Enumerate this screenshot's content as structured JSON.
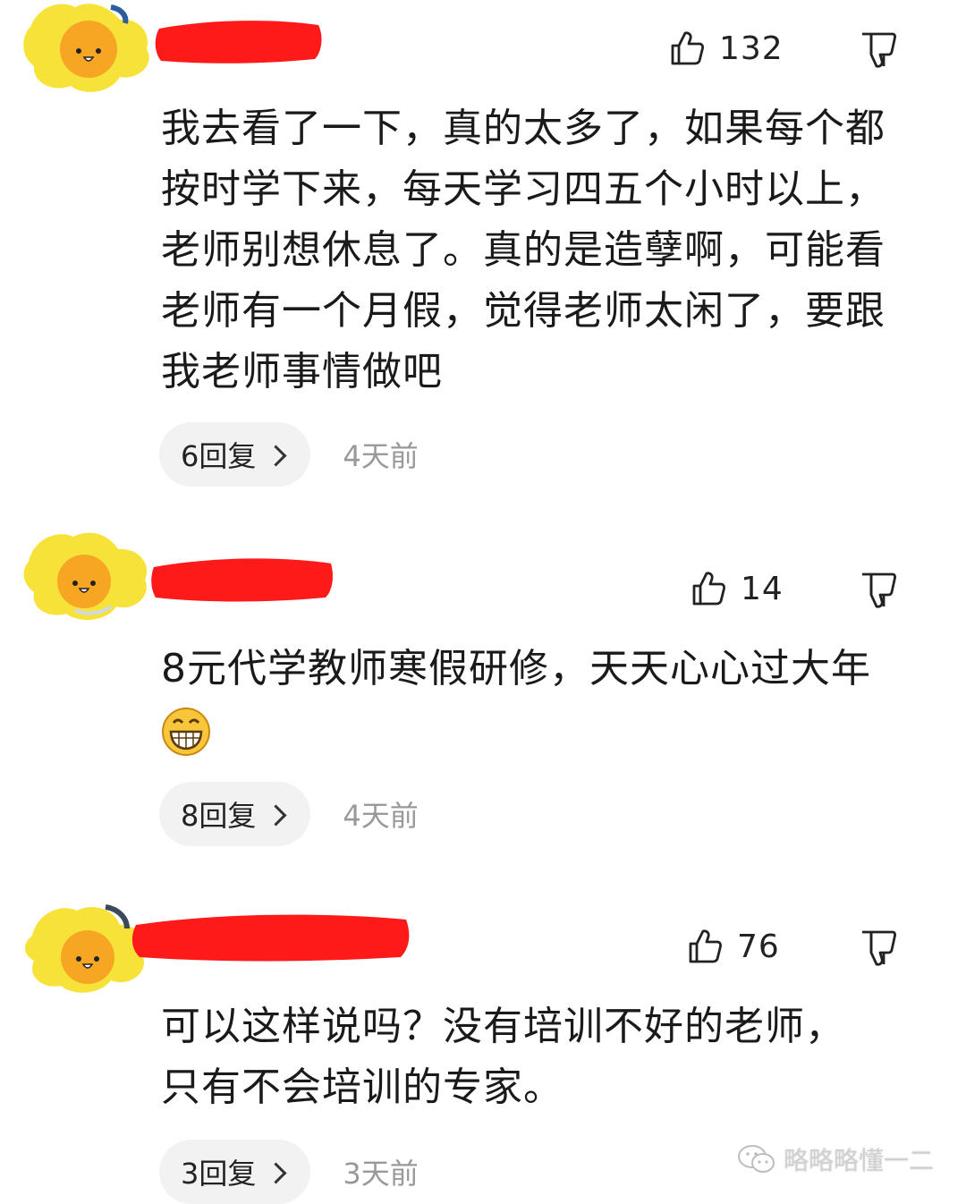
{
  "colors": {
    "avatar_yellow": "#f7e23a",
    "face_orange": "#f6a623",
    "redaction_red": "#ff1a1a",
    "pill_bg": "#f2f2f2",
    "timestamp_gray": "#999999"
  },
  "comments": [
    {
      "likes": "132",
      "text": "我去看了一下，真的太多了，如果每个都按时学下来，每天学习四五个小时以上，老师别想休息了。真的是造孽啊，可能看老师有一个月假，觉得老师太闲了，要跟我老师事情做吧",
      "replies": "6回复",
      "time": "4天前"
    },
    {
      "likes": "14",
      "text": "8元代学教师寒假研修，天天心心过大年",
      "emoji": "grinning-face-icon",
      "replies": "8回复",
      "time": "4天前"
    },
    {
      "likes": "76",
      "text": "可以这样说吗？没有培训不好的老师，只有不会培训的专家。",
      "replies": "3回复",
      "time": "3天前"
    }
  ],
  "watermark": {
    "icon": "wechat-icon",
    "text": "略略略懂一二"
  }
}
